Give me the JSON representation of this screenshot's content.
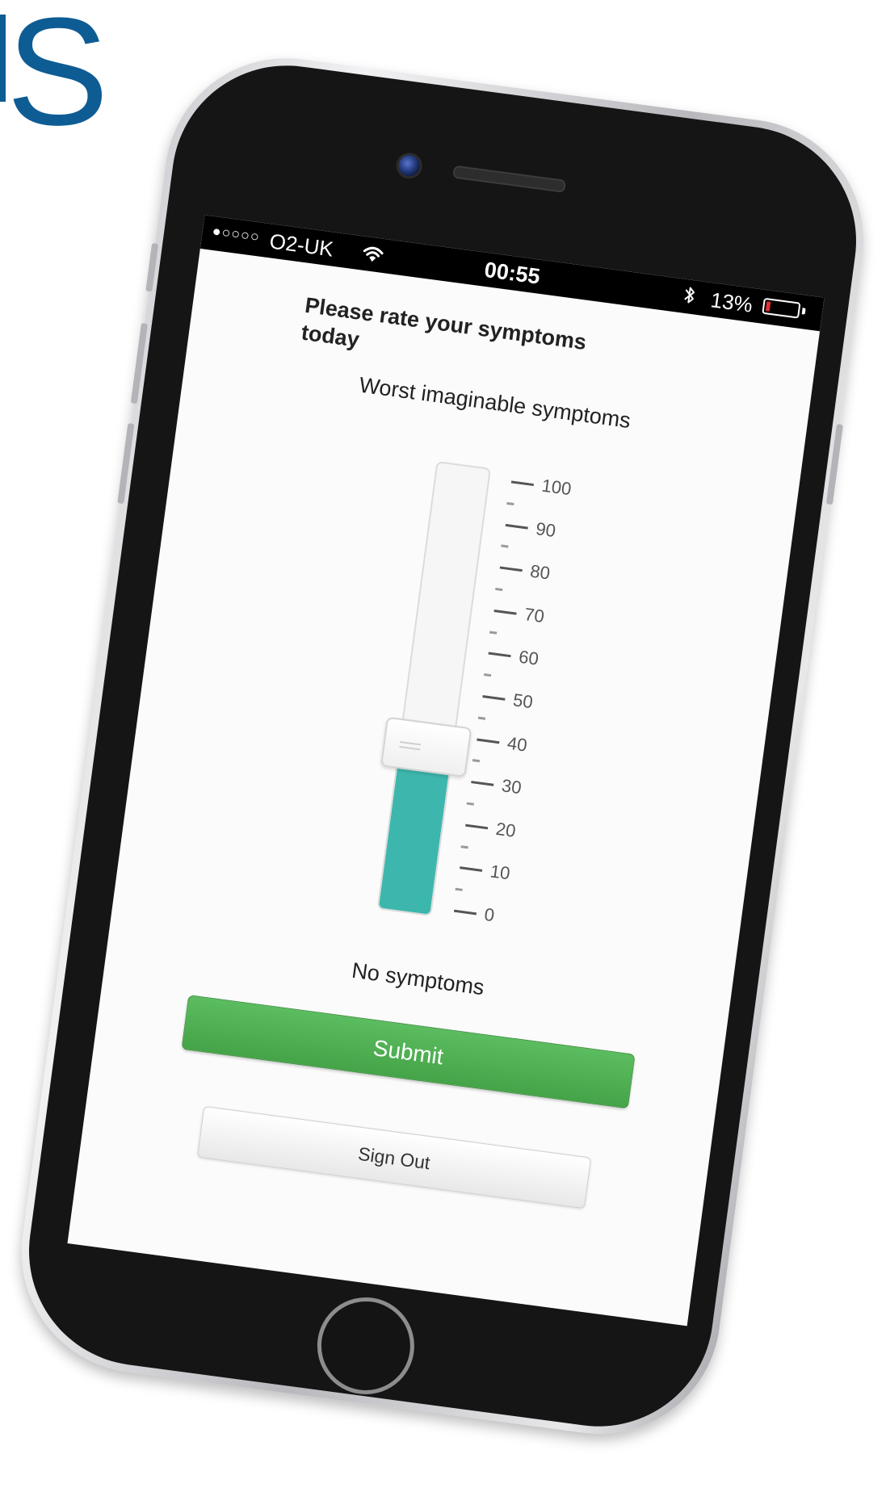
{
  "brand": {
    "letter": "S",
    "color": "#0e5c94"
  },
  "status_bar": {
    "signal": "●○○○○",
    "carrier": "O2-UK",
    "wifi_icon": "wifi-icon",
    "time": "00:55",
    "bluetooth_icon": "bluetooth-icon",
    "battery_percent": "13%",
    "battery_level": 0.13,
    "battery_color": "#e33030"
  },
  "survey": {
    "question": "Please rate your symptoms today",
    "max_label": "Worst imaginable symptoms",
    "min_label": "No symptoms",
    "scale_labels": [
      "100",
      "90",
      "80",
      "70",
      "60",
      "50",
      "40",
      "30",
      "20",
      "10",
      "0"
    ],
    "scale_min": 0,
    "scale_max": 100,
    "value": 37,
    "fill_color": "#3db7ad"
  },
  "actions": {
    "submit_label": "Submit",
    "submit_color": "#4cae4f",
    "sign_out_label": "Sign Out"
  }
}
